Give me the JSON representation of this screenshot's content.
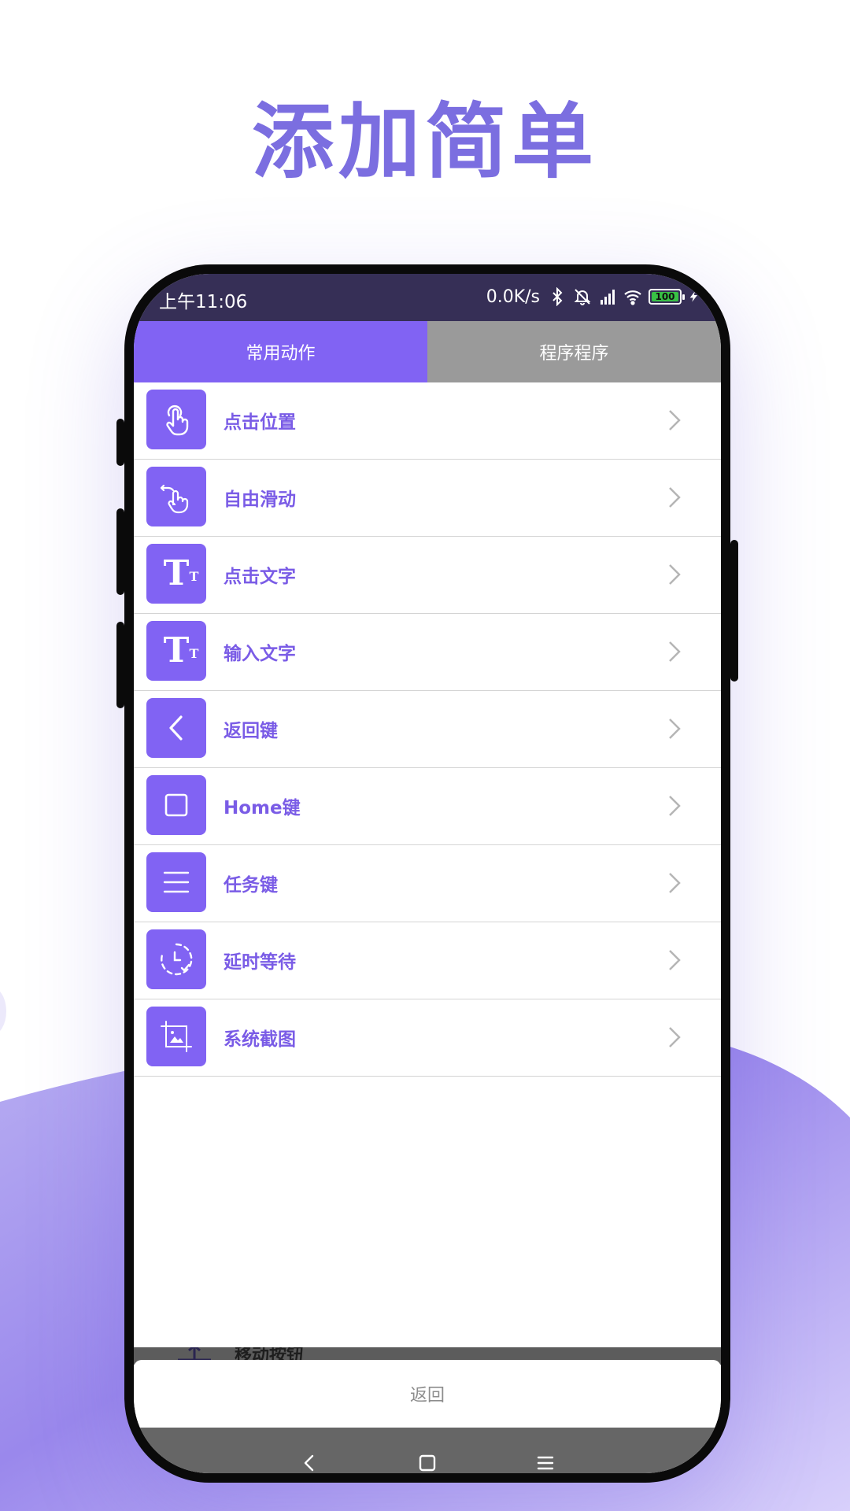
{
  "headline": "添加简单",
  "status_bar": {
    "time": "上午11:06",
    "net_speed": "0.0K/s",
    "battery": "100",
    "icons": [
      "bluetooth-icon",
      "mute-icon",
      "signal-icon",
      "wifi-icon",
      "battery-icon",
      "charging-icon"
    ]
  },
  "tabs": [
    {
      "label": "常用动作",
      "active": true
    },
    {
      "label": "程序程序",
      "active": false
    }
  ],
  "actions": [
    {
      "label": "点击位置",
      "icon": "tap-icon"
    },
    {
      "label": "自由滑动",
      "icon": "swipe-icon"
    },
    {
      "label": "点击文字",
      "icon": "text-icon"
    },
    {
      "label": "输入文字",
      "icon": "text-icon"
    },
    {
      "label": "返回键",
      "icon": "back-icon"
    },
    {
      "label": "Home键",
      "icon": "home-icon"
    },
    {
      "label": "任务键",
      "icon": "menu-icon"
    },
    {
      "label": "延时等待",
      "icon": "timer-icon"
    },
    {
      "label": "系统截图",
      "icon": "screenshot-icon"
    }
  ],
  "peek_item": {
    "label": "移动按钮"
  },
  "back_button": {
    "label": "返回"
  },
  "nav_bar": {
    "icons": [
      "nav-back-icon",
      "nav-home-icon",
      "nav-menu-icon"
    ]
  },
  "colors": {
    "accent": "#8163f3",
    "headline": "#7b6ee0",
    "status_bar": "#362f56",
    "inactive_tab": "#9a9a9a",
    "nav_bar": "#666666"
  }
}
